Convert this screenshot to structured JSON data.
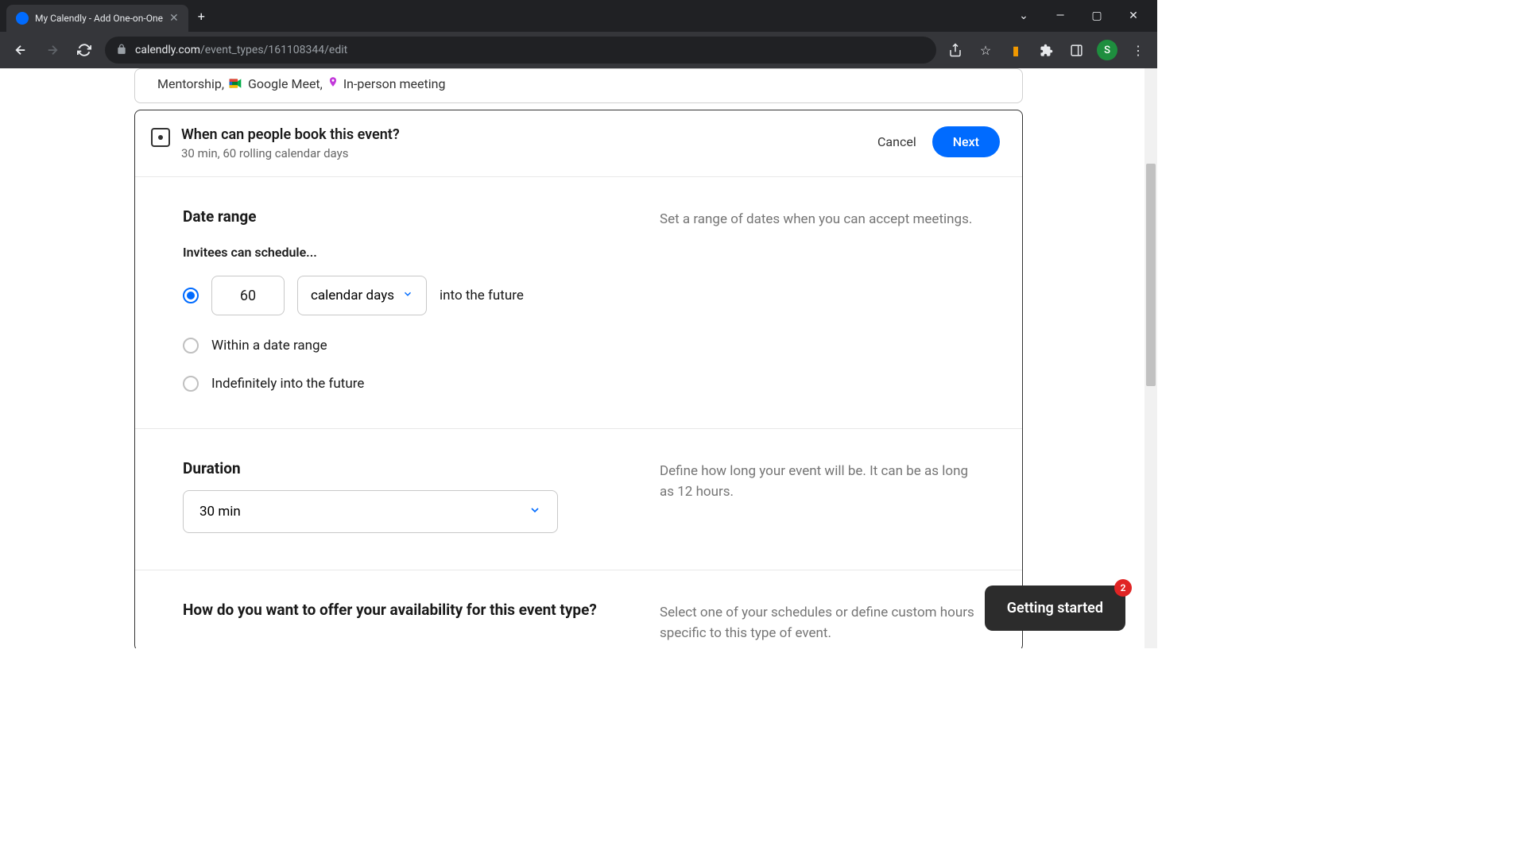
{
  "browser": {
    "tab_title": "My Calendly - Add One-on-One",
    "url_host": "calendly.com",
    "url_path": "/event_types/161108344/edit",
    "avatar_initial": "S"
  },
  "top_card": {
    "name": "Mentorship,",
    "meet": "Google Meet,",
    "inperson": "In-person meeting"
  },
  "header": {
    "title": "When can people book this event?",
    "subtitle": "30 min, 60 rolling calendar days",
    "cancel": "Cancel",
    "next": "Next"
  },
  "date_range": {
    "title": "Date range",
    "subtitle": "Invitees can schedule...",
    "rolling_value": "60",
    "rolling_unit": "calendar days",
    "rolling_suffix": "into the future",
    "option_range": "Within a date range",
    "option_indef": "Indefinitely into the future",
    "help": "Set a range of dates when you can accept meetings."
  },
  "duration": {
    "title": "Duration",
    "value": "30 min",
    "help": "Define how long your event will be. It can be as long as 12 hours."
  },
  "availability": {
    "title": "How do you want to offer your availability for this event type?",
    "help": "Select one of your schedules or define custom hours specific to this type of event."
  },
  "widget": {
    "label": "Getting started",
    "badge": "2"
  }
}
